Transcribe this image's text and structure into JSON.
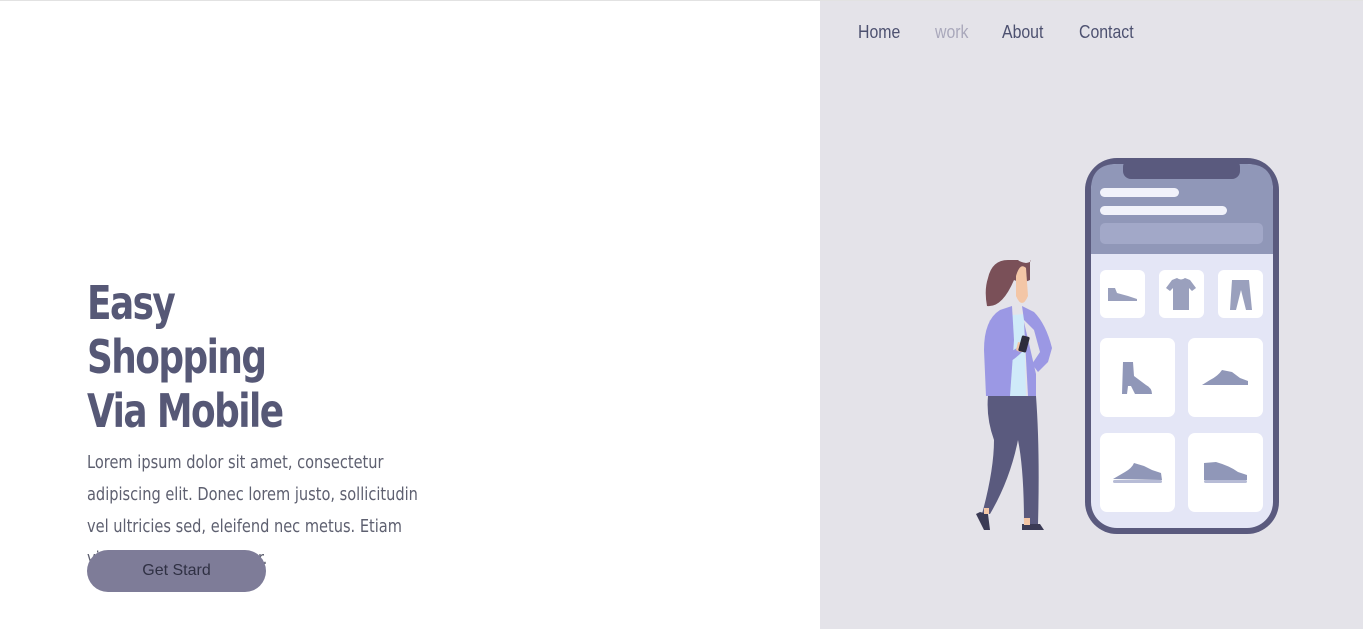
{
  "nav": {
    "items": [
      {
        "label": "Home",
        "state": "normal"
      },
      {
        "label": "work",
        "state": "active"
      },
      {
        "label": "About",
        "state": "normal"
      },
      {
        "label": "Contact",
        "state": "normal"
      }
    ]
  },
  "hero": {
    "title_lines": [
      "Easy",
      "Shopping",
      "Via Mobile"
    ],
    "description": "Lorem ipsum dolor sit amet, consectetur adipiscing elit. Donec lorem justo, sollicitudin vel ultricies sed, eleifend nec metus. Etiam vitae pellentesque dolor.",
    "button_label": "Get Stard"
  },
  "illustration": {
    "icons": [
      "woman-with-phone",
      "smartphone",
      "sneaker-icon",
      "tshirt-icon",
      "pants-icon",
      "boot-icon",
      "running-shoe-icon",
      "sport-shoe-icon",
      "slip-on-shoe-icon"
    ]
  },
  "colors": {
    "heading": "#565876",
    "body_text": "#5e6070",
    "nav_text": "#4d5170",
    "nav_active": "#a9a8bb",
    "button_bg": "#7e7c98",
    "right_panel_bg": "#e4e3e9",
    "phone_frame": "#5a5a7e",
    "phone_header": "#9097b8",
    "phone_screen": "#e4e6f6",
    "accent_jacket": "#9b98e4"
  }
}
